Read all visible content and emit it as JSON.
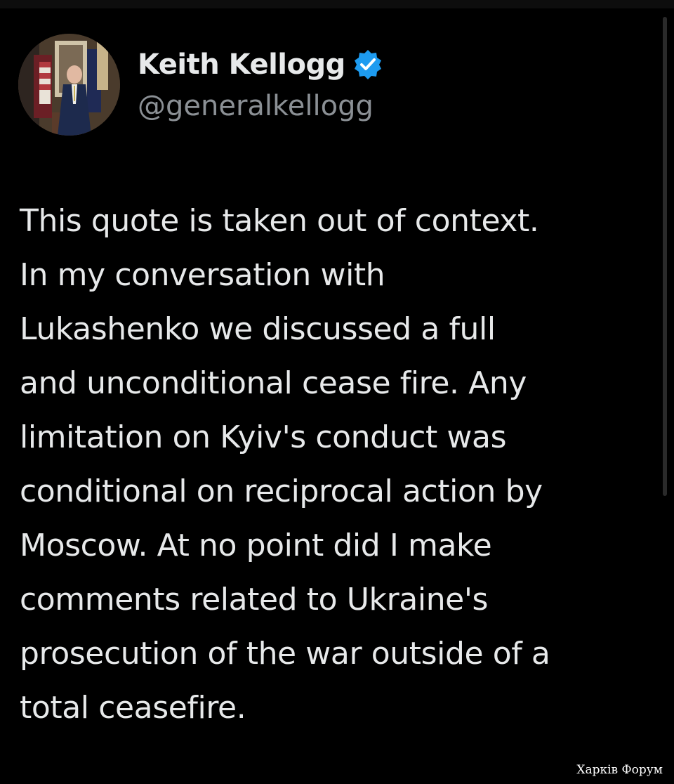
{
  "author": {
    "display_name": "Keith Kellogg",
    "handle": "@generalkellogg",
    "verified": true,
    "verified_color": "#1d9bf0",
    "avatar_icon": "profile-photo-icon",
    "verified_icon": "verified-badge-icon"
  },
  "tweet": {
    "lines": [
      "This quote is taken out of context.",
      "In my conversation with",
      "Lukashenko we discussed a full",
      "and unconditional cease fire. Any",
      "limitation on Kyiv's conduct was",
      "conditional on reciprocal action by",
      "Moscow. At no point did I make",
      "comments related to Ukraine's",
      "prosecution of the war outside of a",
      "total ceasefire."
    ]
  },
  "watermark": "Харків Форум",
  "colors": {
    "background": "#000000",
    "text": "#e7e9ea",
    "secondary_text": "#8b9095"
  }
}
